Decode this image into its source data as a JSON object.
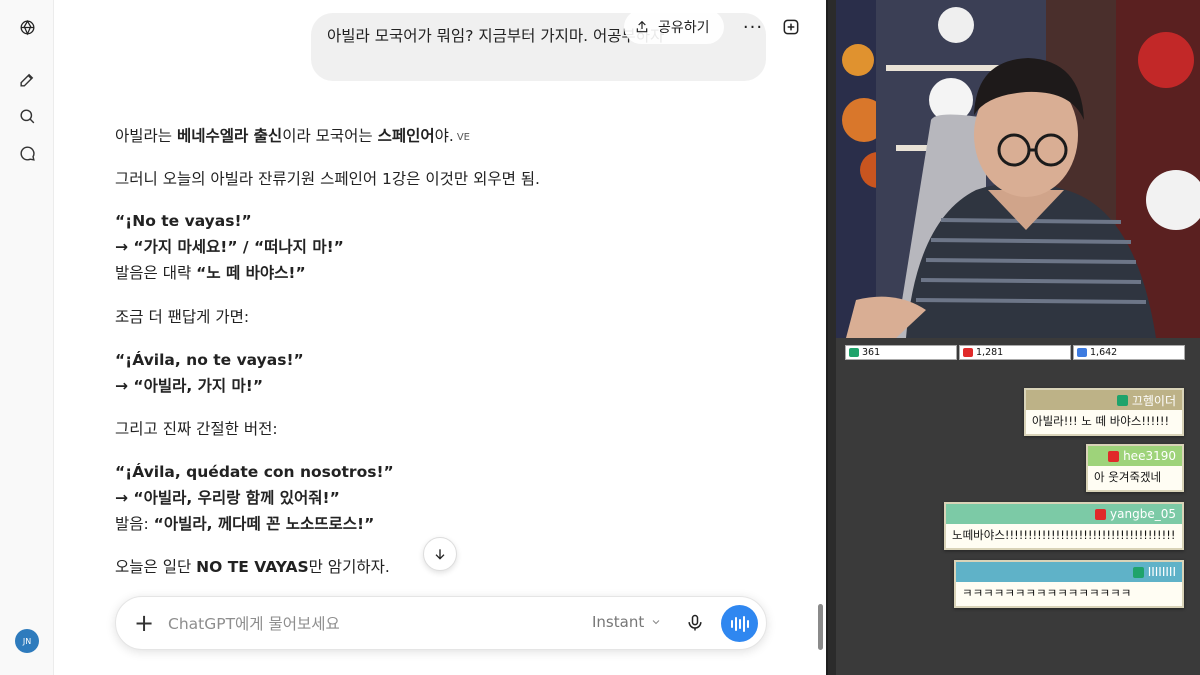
{
  "header": {
    "share_label": "공유하기",
    "more_label": "···"
  },
  "user_message": "아빌라 모국어가 뭐임? 지금부터 가지마. 어공부하자",
  "assistant": {
    "l1": {
      "a": "아빌라는 ",
      "b": "베네수엘라 출신",
      "c": "이라 모국어는 ",
      "d": "스페인어",
      "e": "야.",
      "tag": "VE"
    },
    "l2": "그러니 오늘의 아빌라 잔류기원 스페인어 1강은 이것만 외우면 됨.",
    "l3": "“¡No te vayas!”",
    "l4": "→ “가지 마세요!” / “떠나지 마!”",
    "l5": {
      "a": "발음은 대략 ",
      "b": "“노 떼 바야스!”"
    },
    "l6": "조금 더 팬답게 가면:",
    "l7": "“¡Ávila, no te vayas!”",
    "l8": "→ “아빌라, 가지 마!”",
    "l9": "그리고 진짜 간절한 버전:",
    "l10": "“¡Ávila, quédate con nosotros!”",
    "l11": "→ “아빌라, 우리랑 함께 있어줘!”",
    "l12": {
      "a": "발음: ",
      "b": "“아빌라, 께다떼 꼰 노소뜨로스!”"
    },
    "l13": {
      "a": "오늘은 일단 ",
      "b": "NO TE VAYAS",
      "c": "만 암기하자."
    }
  },
  "composer": {
    "placeholder": "ChatGPT에게 물어보세요",
    "model": "Instant"
  },
  "user_avatar": "JN",
  "stream": {
    "counters": [
      {
        "platform": "chzzk",
        "value": "361",
        "color": "#1fa36b"
      },
      {
        "platform": "youtube",
        "value": "1,281",
        "color": "#e02a2a"
      },
      {
        "platform": "soop",
        "value": "1,642",
        "color": "#3d7be0"
      }
    ],
    "chats": [
      {
        "user": "끄헴이더",
        "text": "아빌라!!! 노 떼 바야스!!!!!!",
        "head_color": "#bdb287"
      },
      {
        "user": "hee3190",
        "text": "아 웃겨죽겠네",
        "head_color": "#9ed37a"
      },
      {
        "user": "yangbe_05",
        "text": "노떼바야스!!!!!!!!!!!!!!!!!!!!!!!!!!!!!!!!!!!!!",
        "head_color": "#7ccaa6"
      },
      {
        "user": "IIIIIIII",
        "text": "ㅋㅋㅋㅋㅋㅋㅋㅋㅋㅋㅋㅋㅋㅋㅋㅋ",
        "head_color": "#5fb2c8"
      }
    ]
  }
}
